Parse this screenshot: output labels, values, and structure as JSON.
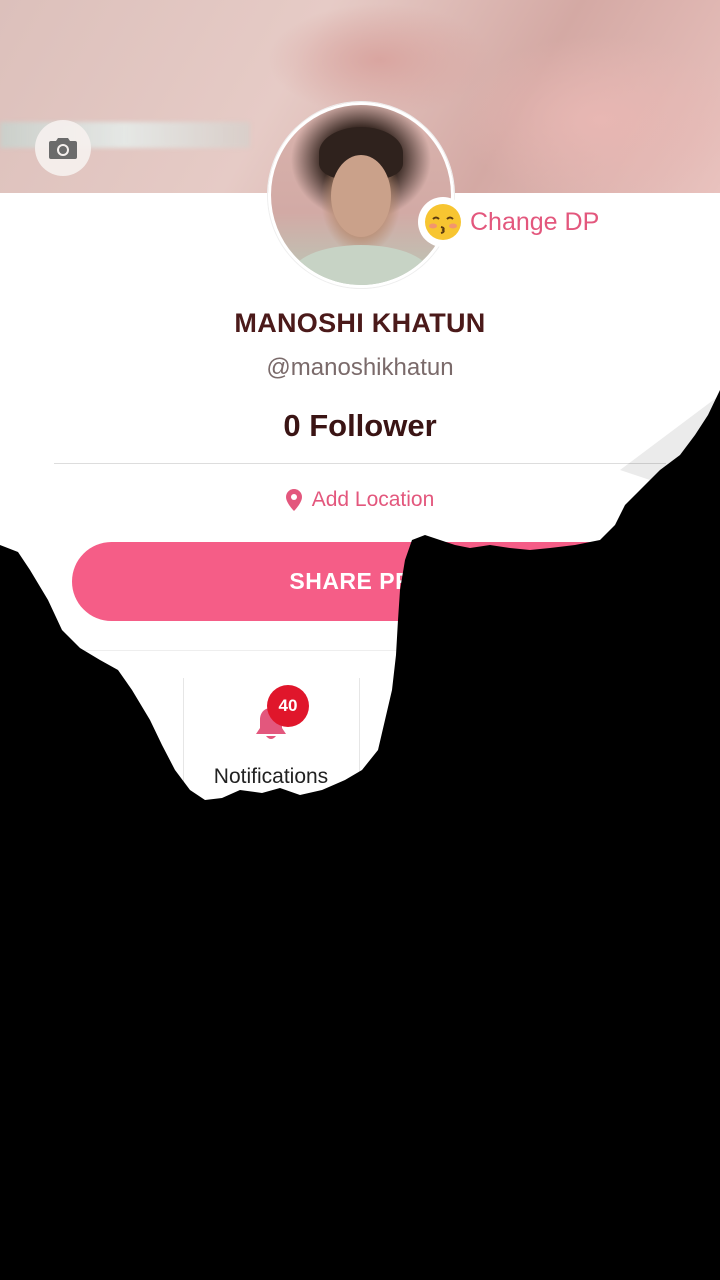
{
  "profile": {
    "name": "MANOSHI KHATUN",
    "handle": "@manoshikhatun",
    "followers": "0 Follower",
    "change_dp_label": "Change DP",
    "change_dp_emoji": "😚",
    "add_location": "Add Location"
  },
  "actions": {
    "share_label": "SHARE PRO"
  },
  "tiles": [
    {
      "label": "Notifications",
      "badge": "40",
      "icon": "bell-icon"
    }
  ],
  "colors": {
    "accent": "#e3577d",
    "share_button": "#f55d87",
    "badge": "#e0162b",
    "name_text": "#4b1a1a"
  },
  "icons": [
    "camera-icon",
    "location-pin-icon",
    "bell-icon"
  ]
}
